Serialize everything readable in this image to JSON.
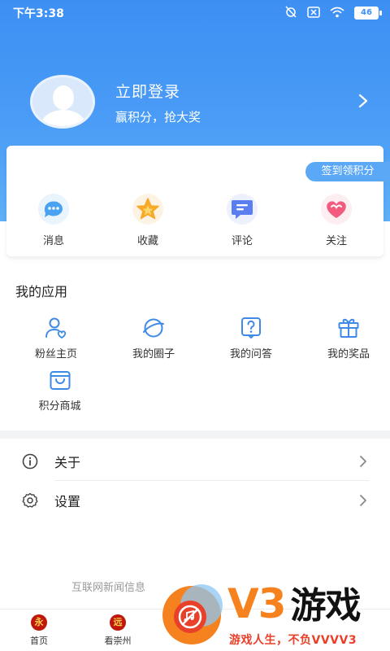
{
  "status_bar": {
    "time": "下午3:38",
    "battery": "46",
    "icons": [
      "alarm-off-icon",
      "sim-off-icon",
      "wifi-icon",
      "battery-icon"
    ]
  },
  "profile": {
    "login_title": "立即登录",
    "login_subtitle": "赢积分，抢大奖",
    "avatar_icon": "default-avatar-icon",
    "arrow_icon": "chevron-right-icon"
  },
  "checkin": {
    "label": "签到领积分"
  },
  "quick_actions": [
    {
      "label": "消息",
      "icon": "message-bubble-icon",
      "color": "#4aa3f2"
    },
    {
      "label": "收藏",
      "icon": "star-icon",
      "color": "#f7a928"
    },
    {
      "label": "评论",
      "icon": "comment-icon",
      "color": "#5a7ef0"
    },
    {
      "label": "关注",
      "icon": "heart-icon",
      "color": "#f25a7e"
    }
  ],
  "apps_section": {
    "title": "我的应用",
    "items": [
      {
        "label": "粉丝主页",
        "icon": "fans-user-heart-icon"
      },
      {
        "label": "我的圈子",
        "icon": "planet-circle-icon"
      },
      {
        "label": "我的问答",
        "icon": "question-icon"
      },
      {
        "label": "我的奖品",
        "icon": "gift-icon"
      },
      {
        "label": "积分商城",
        "icon": "shopping-bag-icon"
      }
    ]
  },
  "menu": [
    {
      "label": "关于",
      "icon": "info-icon"
    },
    {
      "label": "设置",
      "icon": "settings-gear-icon"
    }
  ],
  "footer": {
    "text": "互联网新闻信息"
  },
  "tabbar": [
    {
      "label": "首页",
      "logo": "永"
    },
    {
      "label": "看崇州",
      "logo": "远"
    }
  ],
  "watermark": {
    "brand": "V3",
    "brand_cn": "游戏",
    "slogan": "游戏人生，不负VVVV3"
  },
  "colors": {
    "header_blue": "#3d8ff3",
    "accent_blue": "#5ba8f6",
    "watermark_orange": "#f6821f",
    "watermark_red": "#e9402a"
  }
}
